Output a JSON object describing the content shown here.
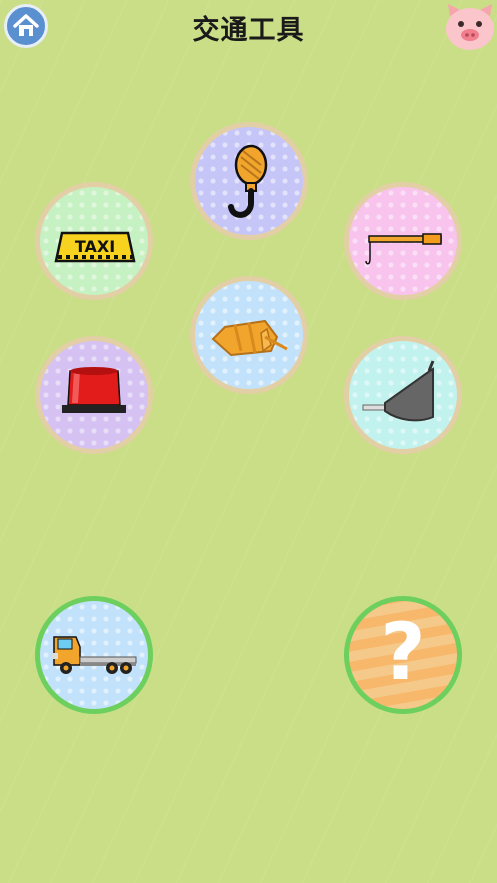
{
  "header": {
    "title": "交通工具"
  },
  "colors": {
    "background": "#c9de86",
    "home_button": "#5a8fd0",
    "completed_ring": "#6ccf5e",
    "pending_ring": "#e3cfa6"
  },
  "parts": [
    {
      "name": "taxi-sign",
      "icon": "taxi-sign-icon",
      "text": "TAXI"
    },
    {
      "name": "crane-hook",
      "icon": "crane-hook-icon"
    },
    {
      "name": "crane-boom",
      "icon": "crane-boom-icon"
    },
    {
      "name": "mixer-drum",
      "icon": "mixer-drum-icon"
    },
    {
      "name": "siren-light",
      "icon": "siren-light-icon"
    },
    {
      "name": "excavator-bucket",
      "icon": "excavator-bucket-icon"
    }
  ],
  "vehicles": [
    {
      "name": "flatbed-truck",
      "icon": "flatbed-truck-icon",
      "status": "completed"
    },
    {
      "name": "locked-vehicle",
      "icon": "question-mark-icon",
      "symbol": "?",
      "status": "locked"
    }
  ]
}
